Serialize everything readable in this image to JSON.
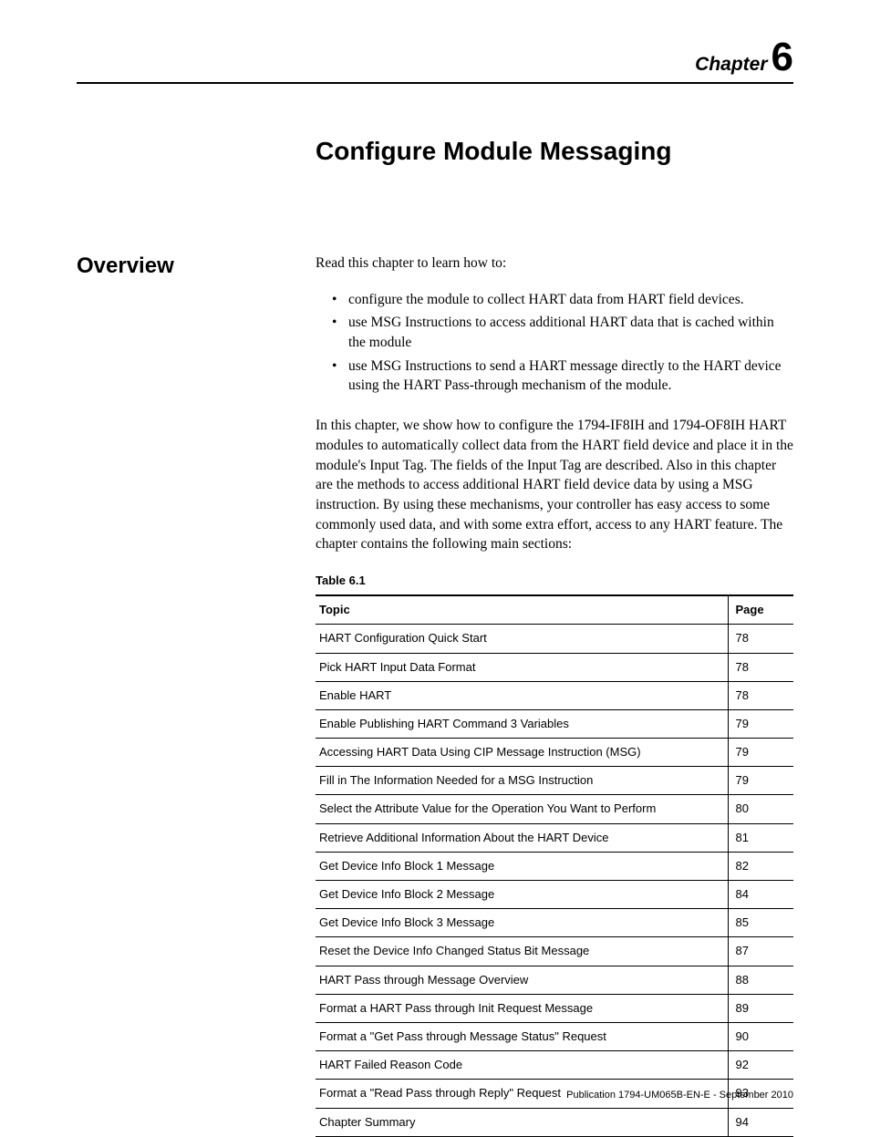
{
  "chapter": {
    "label": "Chapter",
    "number": "6"
  },
  "title": "Configure Module Messaging",
  "section_heading": "Overview",
  "intro_line": "Read this chapter to learn how to:",
  "bullets": [
    "configure the module to collect HART data from HART field devices.",
    "use MSG Instructions to access additional HART data that is cached within the module",
    " use MSG Instructions to send a HART message directly to the HART device using the HART Pass-through mechanism of the module."
  ],
  "body_para": "In this chapter, we show how to configure the 1794-IF8IH and 1794-OF8IH HART modules to automatically collect data from the HART field device and place it in the module's Input Tag. The fields of the Input Tag are described. Also in this chapter are the methods to access additional HART field device data by using a MSG instruction. By using these mechanisms, your controller has easy access to some commonly used data, and with some extra effort, access to any HART feature. The chapter contains the following main sections:",
  "table": {
    "caption": "Table 6.1",
    "headers": {
      "topic": "Topic",
      "page": "Page"
    },
    "rows": [
      {
        "topic": "HART Configuration Quick Start",
        "page": "78"
      },
      {
        "topic": "Pick HART Input Data Format",
        "page": "78"
      },
      {
        "topic": "Enable HART",
        "page": "78"
      },
      {
        "topic": "Enable Publishing HART Command 3 Variables",
        "page": "79"
      },
      {
        "topic": "Accessing HART Data Using CIP Message Instruction (MSG)",
        "page": "79"
      },
      {
        "topic": "Fill in The Information Needed for a MSG Instruction",
        "page": "79"
      },
      {
        "topic": "Select the Attribute Value for the Operation You Want to Perform",
        "page": "80"
      },
      {
        "topic": "Retrieve Additional Information About the HART Device",
        "page": "81"
      },
      {
        "topic": "Get Device Info Block 1 Message",
        "page": "82"
      },
      {
        "topic": "Get Device Info Block 2 Message",
        "page": "84"
      },
      {
        "topic": "Get Device Info Block 3 Message",
        "page": "85"
      },
      {
        "topic": "Reset the Device Info Changed Status Bit Message",
        "page": "87"
      },
      {
        "topic": "HART Pass through Message Overview",
        "page": "88"
      },
      {
        "topic": "Format a HART Pass through Init Request Message",
        "page": "89"
      },
      {
        "topic": "Format a \"Get Pass through Message Status\" Request",
        "page": "90"
      },
      {
        "topic": "HART Failed Reason Code",
        "page": "92"
      },
      {
        "topic": "Format a \"Read Pass through Reply\" Request",
        "page": "93"
      },
      {
        "topic": "Chapter Summary",
        "page": "94"
      }
    ]
  },
  "footer": "Publication 1794-UM065B-EN-E - September 2010"
}
